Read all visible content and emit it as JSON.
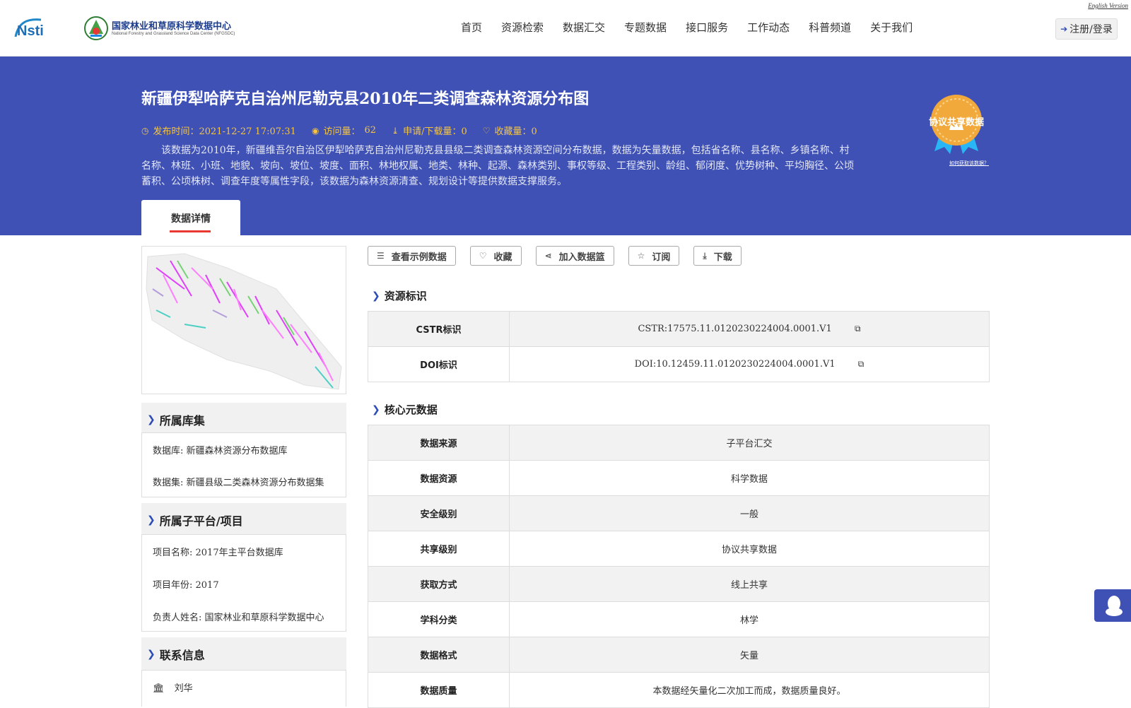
{
  "header": {
    "english_version": "English Version",
    "logo_nsti": "Nsti",
    "center_name_cn": "国家林业和草原科学数据中心",
    "center_name_en": "National Forestry and Grassland Science Data Center (NFGSDC)",
    "nav": [
      "首页",
      "资源检索",
      "数据汇交",
      "专题数据",
      "接口服务",
      "工作动态",
      "科普频道",
      "关于我们"
    ],
    "login": "注册/登录"
  },
  "banner": {
    "title": "新疆伊犁哈萨克自治州尼勒克县2010年二类调查森林资源分布图",
    "meta": {
      "publish_label": "发布时间：2021-12-27 17:07:31",
      "visits_label": "访问量：",
      "visits_value": "62",
      "downloads_label": "申请/下载量：0",
      "favorites_label": "收藏量：0"
    },
    "description": "该数据为2010年，新疆维吾尔自治区伊犁哈萨克自治州尼勒克县县级二类调查森林资源空间分布数据，数据为矢量数据，包括省名称、县名称、乡镇名称、村名称、林班、小班、地貌、坡向、坡位、坡度、面积、林地权属、地类、林种、起源、森林类别、事权等级、工程类别、龄组、郁闭度、优势树种、平均胸径、公顷蓄积、公顷株树、调查年度等属性字段，该数据为森林资源清查、规划设计等提供数据支撑服务。",
    "badge_text": "协议共享数据",
    "badge_help": "如何获取该数据？",
    "tab": "数据详情"
  },
  "sidebar": {
    "library_title": "所属库集",
    "library_items": [
      "数据库: 新疆森林资源分布数据库",
      "数据集: 新疆县级二类森林资源分布数据集"
    ],
    "project_title": "所属子平台/项目",
    "project_items": [
      "项目名称: 2017年主平台数据库",
      "项目年份: 2017",
      "负责人姓名: 国家林业和草原科学数据中心"
    ],
    "contact_title": "联系信息",
    "contact_name": "刘华"
  },
  "actions": [
    "查看示例数据",
    "收藏",
    "加入数据篮",
    "订阅",
    "下载"
  ],
  "identifiers": {
    "title": "资源标识",
    "rows": [
      {
        "key": "CSTR标识",
        "value": "CSTR:17575.11.0120230224004.0001.V1"
      },
      {
        "key": "DOI标识",
        "value": "DOI:10.12459.11.0120230224004.0001.V1"
      }
    ]
  },
  "core_meta": {
    "title": "核心元数据",
    "rows": [
      {
        "key": "数据来源",
        "value": "子平台汇交"
      },
      {
        "key": "数据资源",
        "value": "科学数据"
      },
      {
        "key": "安全级别",
        "value": "一般"
      },
      {
        "key": "共享级别",
        "value": "协议共享数据"
      },
      {
        "key": "获取方式",
        "value": "线上共享"
      },
      {
        "key": "学科分类",
        "value": "林学"
      },
      {
        "key": "数据格式",
        "value": "矢量"
      },
      {
        "key": "数据质量",
        "value": "本数据经矢量化二次加工而成，数据质量良好。"
      }
    ]
  },
  "colors": {
    "brand_blue": "#3f51b5",
    "meta_gold": "#f5c542",
    "tab_red": "#e8382f"
  }
}
